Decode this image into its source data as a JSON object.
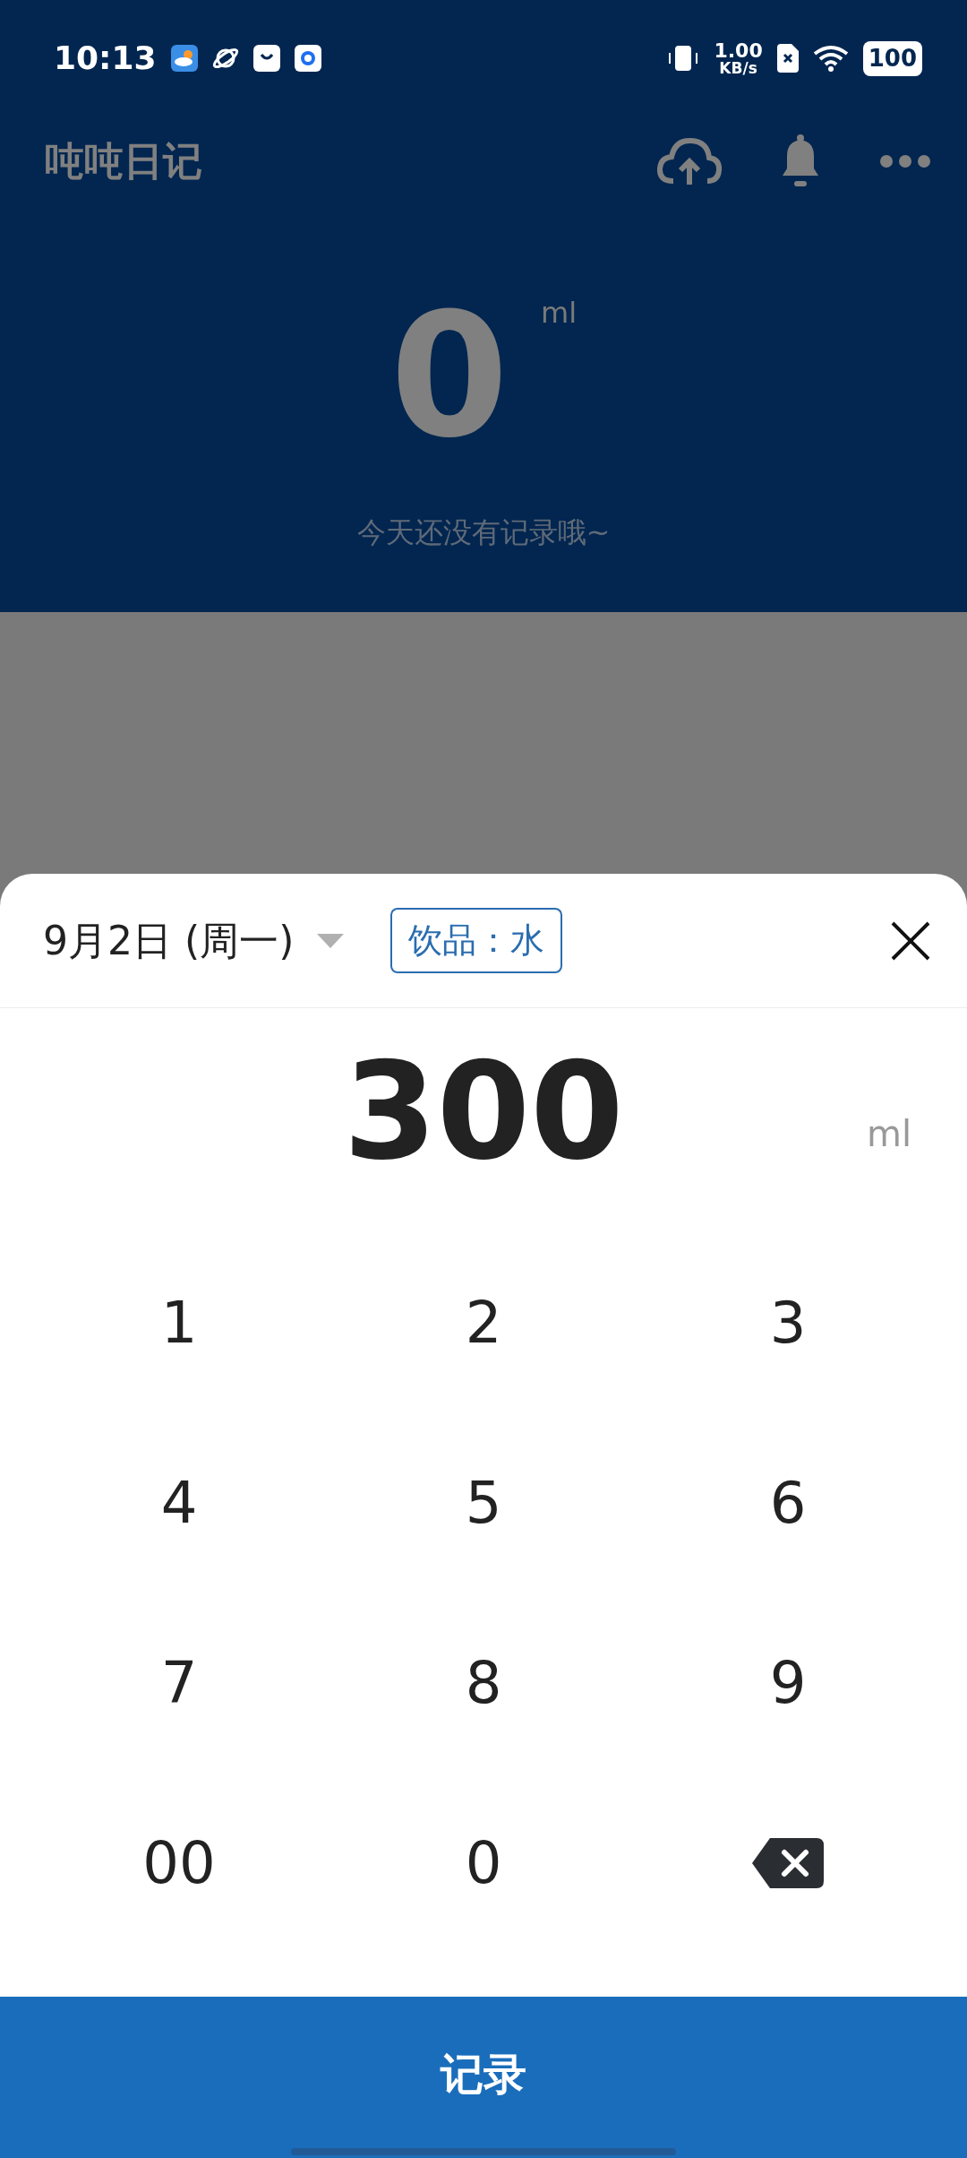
{
  "status_bar": {
    "time": "10:13",
    "net_speed_value": "1.00",
    "net_speed_unit": "KB/s",
    "battery": "100"
  },
  "app_bar": {
    "title": "吨吨日记"
  },
  "summary": {
    "amount": "0",
    "unit": "ml",
    "message": "今天还没有记录哦~"
  },
  "sheet": {
    "date": "9月2日 (周一)",
    "drink_tag": "饮品：水",
    "amount": "300",
    "unit": "ml",
    "keys": [
      {
        "kind": "digit",
        "label": "1"
      },
      {
        "kind": "digit",
        "label": "2"
      },
      {
        "kind": "digit",
        "label": "3"
      },
      {
        "kind": "digit",
        "label": "4"
      },
      {
        "kind": "digit",
        "label": "5"
      },
      {
        "kind": "digit",
        "label": "6"
      },
      {
        "kind": "digit",
        "label": "7"
      },
      {
        "kind": "digit",
        "label": "8"
      },
      {
        "kind": "digit",
        "label": "9"
      },
      {
        "kind": "digit",
        "label": "00"
      },
      {
        "kind": "digit",
        "label": "0"
      },
      {
        "kind": "backspace"
      }
    ],
    "submit": "记录"
  }
}
